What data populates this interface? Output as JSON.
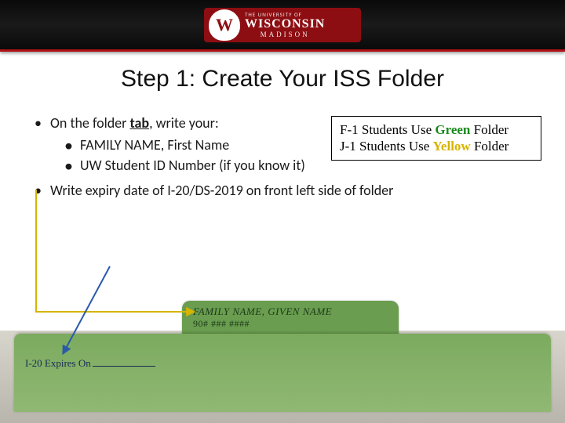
{
  "header": {
    "logo_top": "THE UNIVERSITY OF",
    "logo_main": "WISCONSIN",
    "logo_sub": "MADISON",
    "crest_letter": "W"
  },
  "title": "Step 1: Create Your ISS Folder",
  "bullets": {
    "b1_pre": "On the folder ",
    "b1_tab": "tab",
    "b1_post": ", write your:",
    "sub1": "FAMILY NAME, First Name",
    "sub2": "UW Student ID Number (if you know it)",
    "b2": "Write expiry date of I-20/DS-2019 on front left side of folder"
  },
  "infobox": {
    "line1_pre": "F-1 Students Use ",
    "line1_green": "Green",
    "line1_post": " Folder",
    "line2_pre": "J-1 Students Use ",
    "line2_yellow": "Yellow",
    "line2_post": " Folder"
  },
  "folder": {
    "tab_line1": "FAMILY NAME, GIVEN NAME",
    "tab_line2": "90# ### ####",
    "expiry_label": "I-20 Expires On"
  }
}
